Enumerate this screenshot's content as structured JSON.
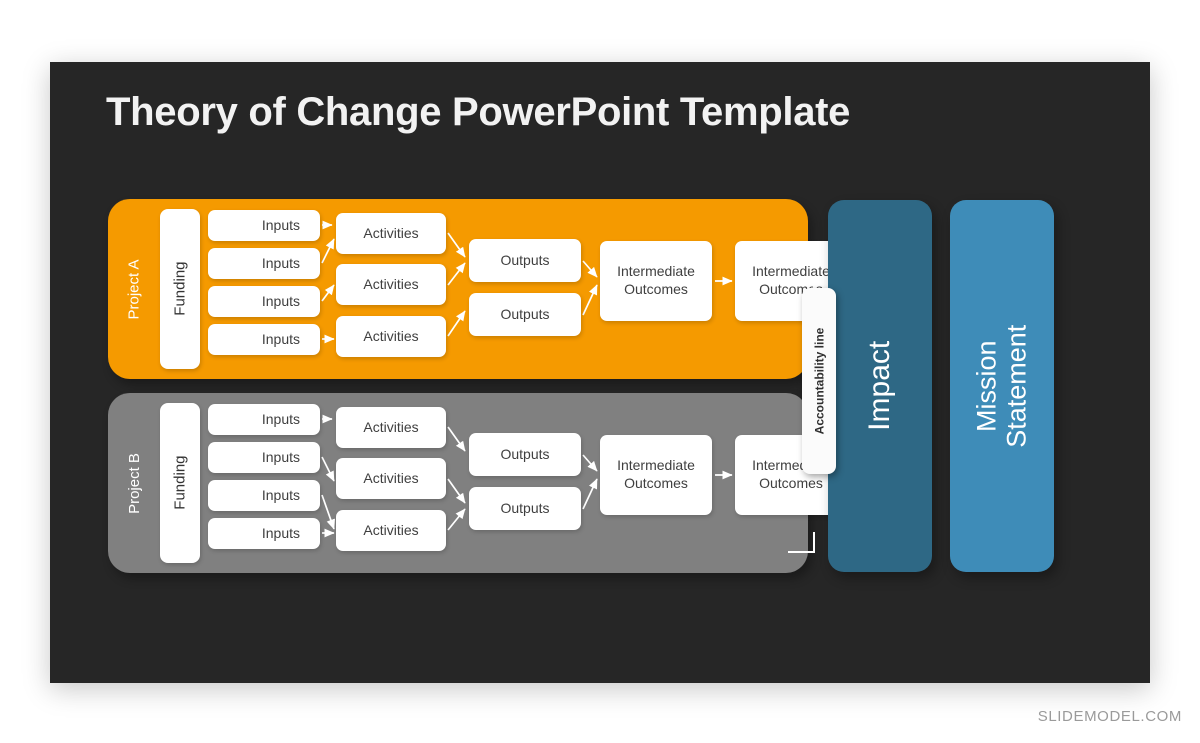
{
  "slide": {
    "title": "Theory of Change PowerPoint Template",
    "background_color": "#262626"
  },
  "watermark": {
    "text": "SLIDEMODEL.COM"
  },
  "projects": [
    {
      "id": "project-a",
      "label": "Project A",
      "band_color": "#F59A00",
      "funding_label": "Funding",
      "inputs": [
        "Inputs",
        "Inputs",
        "Inputs",
        "Inputs"
      ],
      "activities": [
        "Activities",
        "Activities",
        "Activities"
      ],
      "outputs": [
        "Outputs",
        "Outputs"
      ],
      "outcome_1": "Intermediate Outcomes",
      "outcome_2": "Intermediate Outcomes"
    },
    {
      "id": "project-b",
      "label": "Project B",
      "band_color": "#808080",
      "funding_label": "Funding",
      "inputs": [
        "Inputs",
        "Inputs",
        "Inputs",
        "Inputs"
      ],
      "activities": [
        "Activities",
        "Activities",
        "Activities"
      ],
      "outputs": [
        "Outputs",
        "Outputs"
      ],
      "outcome_1": "Intermediate Outcomes",
      "outcome_2": "Intermediate Outcomes"
    }
  ],
  "accountability": {
    "label": "Accountability line"
  },
  "panels": {
    "impact": {
      "label": "Impact",
      "color": "#2E6885"
    },
    "mission": {
      "label": "Mission Statement",
      "color": "#3E8CB8"
    }
  }
}
